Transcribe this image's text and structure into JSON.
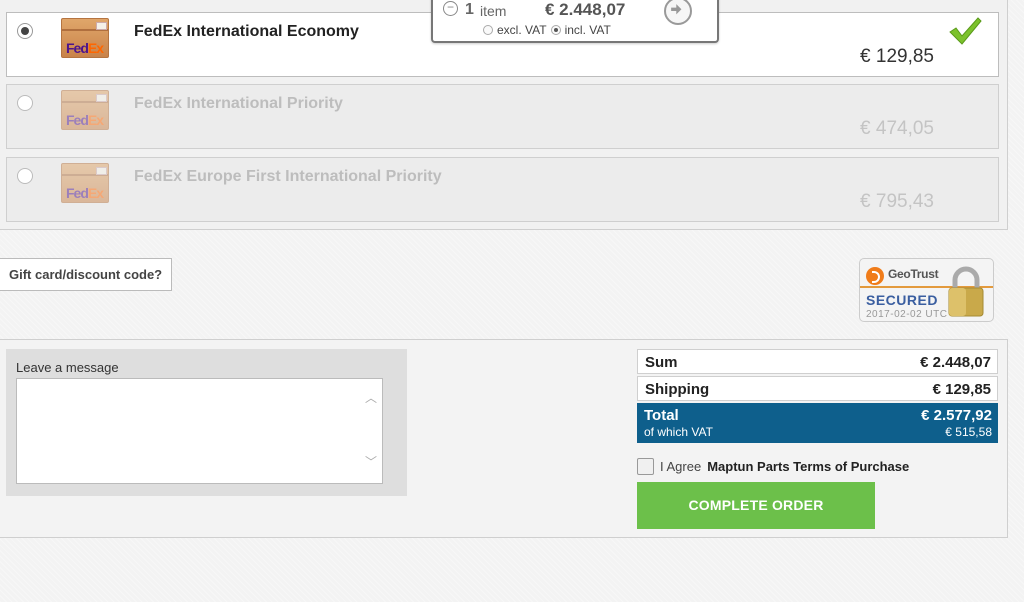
{
  "shipping": {
    "options": [
      {
        "name": "FedEx International Economy",
        "price": "€ 129,85",
        "selected": true
      },
      {
        "name": "FedEx International Priority",
        "price": "€ 474,05",
        "selected": false
      },
      {
        "name": "FedEx Europe First International Priority",
        "price": "€ 795,43",
        "selected": false
      }
    ],
    "logo": {
      "fed": "Fed",
      "ex": "Ex"
    }
  },
  "mini_cart": {
    "count": "1",
    "count_label": "item",
    "total": "€ 2.448,07",
    "excl_vat_label": "excl. VAT",
    "incl_vat_label": "incl. VAT",
    "selected_vat": "incl"
  },
  "gift": {
    "label": "Gift card/discount code?"
  },
  "badge": {
    "brand": "GeoTrust",
    "secured": "SECURED",
    "date": "2017-02-02 UTC"
  },
  "message": {
    "label": "Leave a message",
    "value": ""
  },
  "summary": {
    "sum_label": "Sum",
    "sum_value": "€ 2.448,07",
    "shipping_label": "Shipping",
    "shipping_value": "€ 129,85",
    "total_label": "Total",
    "total_value": "€ 2.577,92",
    "vat_label": "of which VAT",
    "vat_value": "€ 515,58"
  },
  "terms": {
    "prefix": "I Agree",
    "link": "Maptun Parts Terms of Purchase"
  },
  "complete": {
    "label": "COMPLETE ORDER"
  },
  "colors": {
    "total_bg": "#0e5f8c",
    "complete_bg": "#6cc04a",
    "check": "#7cc22c"
  }
}
